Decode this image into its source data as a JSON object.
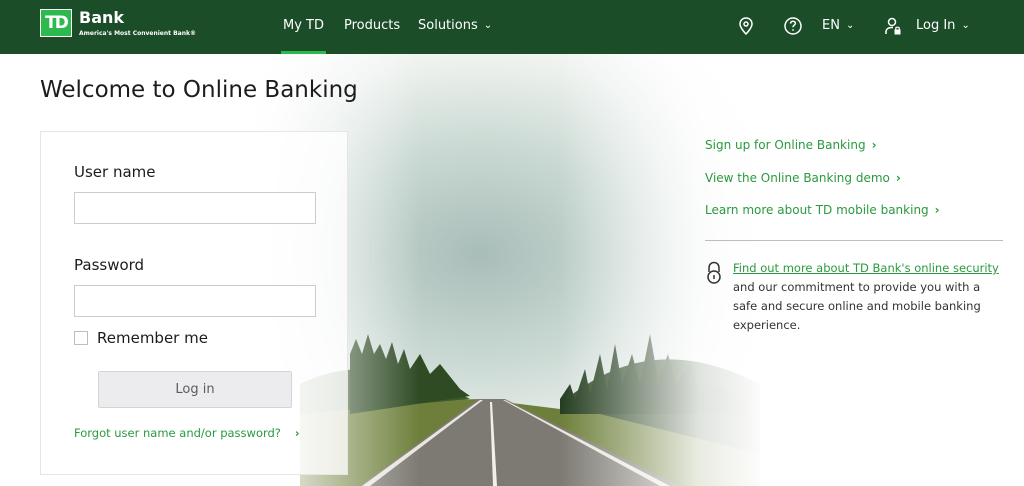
{
  "header": {
    "logo_mark": "TD",
    "logo_name": "Bank",
    "logo_tagline": "America's Most Convenient Bank®",
    "nav": [
      {
        "label": "My TD"
      },
      {
        "label": "Products"
      },
      {
        "label": "Solutions"
      }
    ],
    "language": "EN",
    "login_label": "Log In",
    "icons": [
      "location-pin-icon",
      "help-icon",
      "user-lock-icon",
      "chevron-down-icon"
    ]
  },
  "page": {
    "title": "Welcome to Online Banking"
  },
  "login_form": {
    "username_label": "User name",
    "username_value": "",
    "password_label": "Password",
    "password_value": "",
    "remember_label": "Remember me",
    "remember_checked": false,
    "login_button": "Log in",
    "forgot_link": "Forgot user name and/or password?"
  },
  "side_links": [
    {
      "label": "Sign up for Online Banking"
    },
    {
      "label": "View the Online Banking demo"
    },
    {
      "label": "Learn more about TD mobile banking"
    }
  ],
  "security": {
    "link": "Find out more about TD Bank's online security",
    "text": " and our commitment to provide you with a safe and secure online and mobile banking experience."
  },
  "colors": {
    "header_bg": "#1b4d29",
    "accent_green": "#2db94d",
    "link_green": "#2a9a3e"
  }
}
